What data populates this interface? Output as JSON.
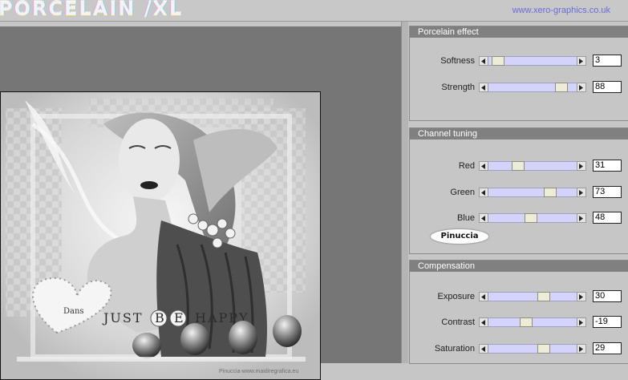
{
  "header": {
    "title": "PORCELAIN /XL",
    "site_link": "www.xero-graphics.co.uk"
  },
  "preview": {
    "caption_just": "JUST",
    "caption_b": "B",
    "caption_e": "E",
    "caption_happy": "HAPPY",
    "bubble_text": "Dans",
    "watermark": "Pinuccia-www.maidiregrafica.eu"
  },
  "panels": {
    "porcelain": {
      "title": "Porcelain effect",
      "rows": [
        {
          "label": "Softness",
          "value": "3",
          "fraction": 0.04
        },
        {
          "label": "Strength",
          "value": "88",
          "fraction": 0.88
        }
      ]
    },
    "channel": {
      "title": "Channel tuning",
      "rows": [
        {
          "label": "Red",
          "value": "31",
          "fraction": 0.31
        },
        {
          "label": "Green",
          "value": "73",
          "fraction": 0.73
        },
        {
          "label": "Blue",
          "value": "48",
          "fraction": 0.48
        }
      ],
      "signature": "Pinuccia"
    },
    "compensation": {
      "title": "Compensation",
      "rows": [
        {
          "label": "Exposure",
          "value": "30",
          "fraction": 0.65
        },
        {
          "label": "Contrast",
          "value": "-19",
          "fraction": 0.41
        },
        {
          "label": "Saturation",
          "value": "29",
          "fraction": 0.645
        }
      ]
    }
  },
  "colors": {
    "panel_title_bg": "#808080",
    "track": "#d4d4fa",
    "link": "#6a6ad8"
  }
}
